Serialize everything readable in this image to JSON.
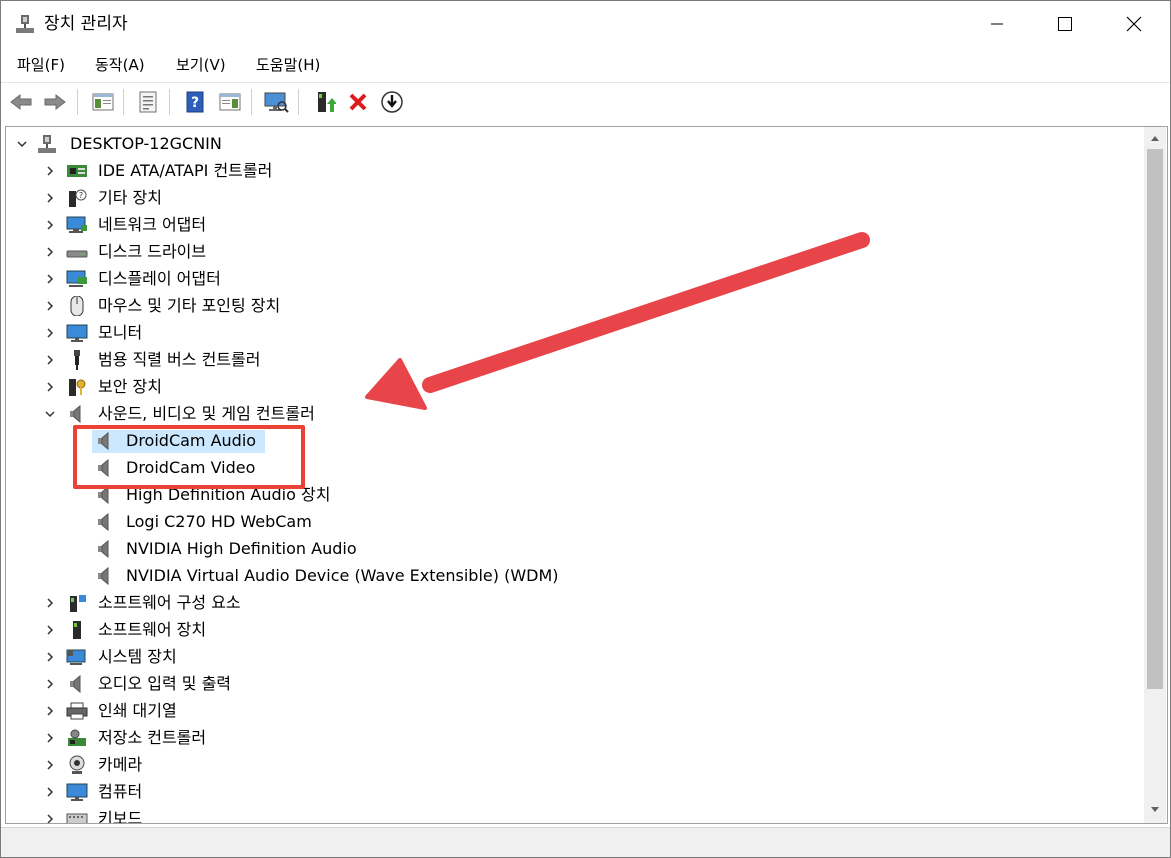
{
  "window": {
    "title": "장치 관리자",
    "icon": "device-manager-icon"
  },
  "menu": [
    {
      "label": "파일(F)"
    },
    {
      "label": "동작(A)"
    },
    {
      "label": "보기(V)"
    },
    {
      "label": "도움말(H)"
    }
  ],
  "toolbar": {
    "buttons": [
      "back-icon",
      "forward-icon",
      "show-hide-console-tree-icon",
      "properties-icon",
      "help-icon",
      "action-pane-icon",
      "scan-hardware-icon",
      "update-driver-icon",
      "uninstall-icon",
      "disable-device-icon"
    ]
  },
  "tree": {
    "root": "DESKTOP-12GCNIN",
    "categories": [
      {
        "label": "IDE ATA/ATAPI 컨트롤러",
        "icon": "ide-controller-icon"
      },
      {
        "label": "기타 장치",
        "icon": "other-devices-icon"
      },
      {
        "label": "네트워크 어댑터",
        "icon": "network-adapter-icon"
      },
      {
        "label": "디스크 드라이브",
        "icon": "disk-drive-icon"
      },
      {
        "label": "디스플레이 어댑터",
        "icon": "display-adapter-icon"
      },
      {
        "label": "마우스 및 기타 포인팅 장치",
        "icon": "mouse-icon"
      },
      {
        "label": "모니터",
        "icon": "monitor-icon"
      },
      {
        "label": "범용 직렬 버스 컨트롤러",
        "icon": "usb-icon"
      },
      {
        "label": "보안 장치",
        "icon": "security-device-icon"
      },
      {
        "label": "사운드, 비디오 및 게임 컨트롤러",
        "icon": "speaker-icon",
        "expanded": true
      },
      {
        "label": "소프트웨어 구성 요소",
        "icon": "software-component-icon"
      },
      {
        "label": "소프트웨어 장치",
        "icon": "software-device-icon"
      },
      {
        "label": "시스템 장치",
        "icon": "system-device-icon"
      },
      {
        "label": "오디오 입력 및 출력",
        "icon": "speaker-icon"
      },
      {
        "label": "인쇄 대기열",
        "icon": "printer-icon"
      },
      {
        "label": "저장소 컨트롤러",
        "icon": "storage-controller-icon"
      },
      {
        "label": "카메라",
        "icon": "camera-icon"
      },
      {
        "label": "컴퓨터",
        "icon": "computer-icon"
      },
      {
        "label": "키보드",
        "icon": "keyboard-icon"
      }
    ],
    "sound_children": [
      {
        "label": "DroidCam Audio",
        "selected": true
      },
      {
        "label": "DroidCam Video"
      },
      {
        "label": "High Definition Audio 장치"
      },
      {
        "label": "Logi C270 HD WebCam"
      },
      {
        "label": "NVIDIA High Definition Audio"
      },
      {
        "label": "NVIDIA Virtual Audio Device (Wave Extensible) (WDM)"
      }
    ]
  },
  "colors": {
    "selection": "#cce8ff",
    "annotation_red": "#ea4335",
    "arrow_red": "#e8454a"
  }
}
